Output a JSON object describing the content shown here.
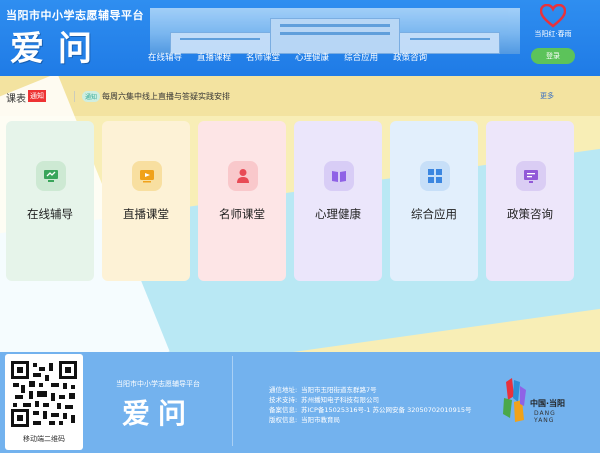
{
  "header": {
    "site_title": "当阳市中小学志愿辅导平台",
    "logo_text": "爱问",
    "nav": [
      "在线辅导",
      "直播课程",
      "名师课堂",
      "心理健康",
      "综合应用",
      "政策咨询"
    ],
    "brand_caption": "当阳红·春雨",
    "login_label": "登录"
  },
  "notice": {
    "label": "课表",
    "badge": "通知",
    "tag": "通知",
    "message": "每周六集中线上直播与答疑实践安排",
    "more": "更多"
  },
  "cards": [
    {
      "label": "在线辅导",
      "icon": "online-tutoring-icon",
      "bg": "#e6f4ea",
      "icon_bg": "#cde9d3",
      "icon_color": "#3aa55b"
    },
    {
      "label": "直播课堂",
      "icon": "live-class-icon",
      "bg": "#fdf2d6",
      "icon_bg": "#f8dfa0",
      "icon_color": "#f0a21a"
    },
    {
      "label": "名师课堂",
      "icon": "famous-teacher-icon",
      "bg": "#fde5e6",
      "icon_bg": "#f9c8cb",
      "icon_color": "#e84a55"
    },
    {
      "label": "心理健康",
      "icon": "mental-health-icon",
      "bg": "#ebe6fb",
      "icon_bg": "#d8cdf6",
      "icon_color": "#8f62e6"
    },
    {
      "label": "综合应用",
      "icon": "apps-icon",
      "bg": "#e2effc",
      "icon_bg": "#c7dff8",
      "icon_color": "#3b86e0"
    },
    {
      "label": "政策咨询",
      "icon": "policy-consult-icon",
      "bg": "#ede6fa",
      "icon_bg": "#dacdf4",
      "icon_color": "#9259d8"
    }
  ],
  "footer": {
    "qr_caption": "移动端二维码",
    "title": "当阳市中小学志愿辅导平台",
    "logo_text": "爱问",
    "info": [
      {
        "label": "通信地址:",
        "value": "当阳市玉阳街道东群路7号"
      },
      {
        "label": "技术支持:",
        "value": "苏州播知电子科技有限公司"
      },
      {
        "label": "备案信息:",
        "value": "苏ICP备15025316号-1 苏公网安备 32050702010915号"
      },
      {
        "label": "版权信息:",
        "value": "当阳市教育局"
      }
    ],
    "brand_cn": "中国·当阳",
    "brand_en": "DANG YANG"
  },
  "colors": {
    "header_blue": "#1f7be6",
    "footer_blue": "#73b2ee",
    "login_green": "#5cc35a",
    "notice_red": "#e33333"
  }
}
